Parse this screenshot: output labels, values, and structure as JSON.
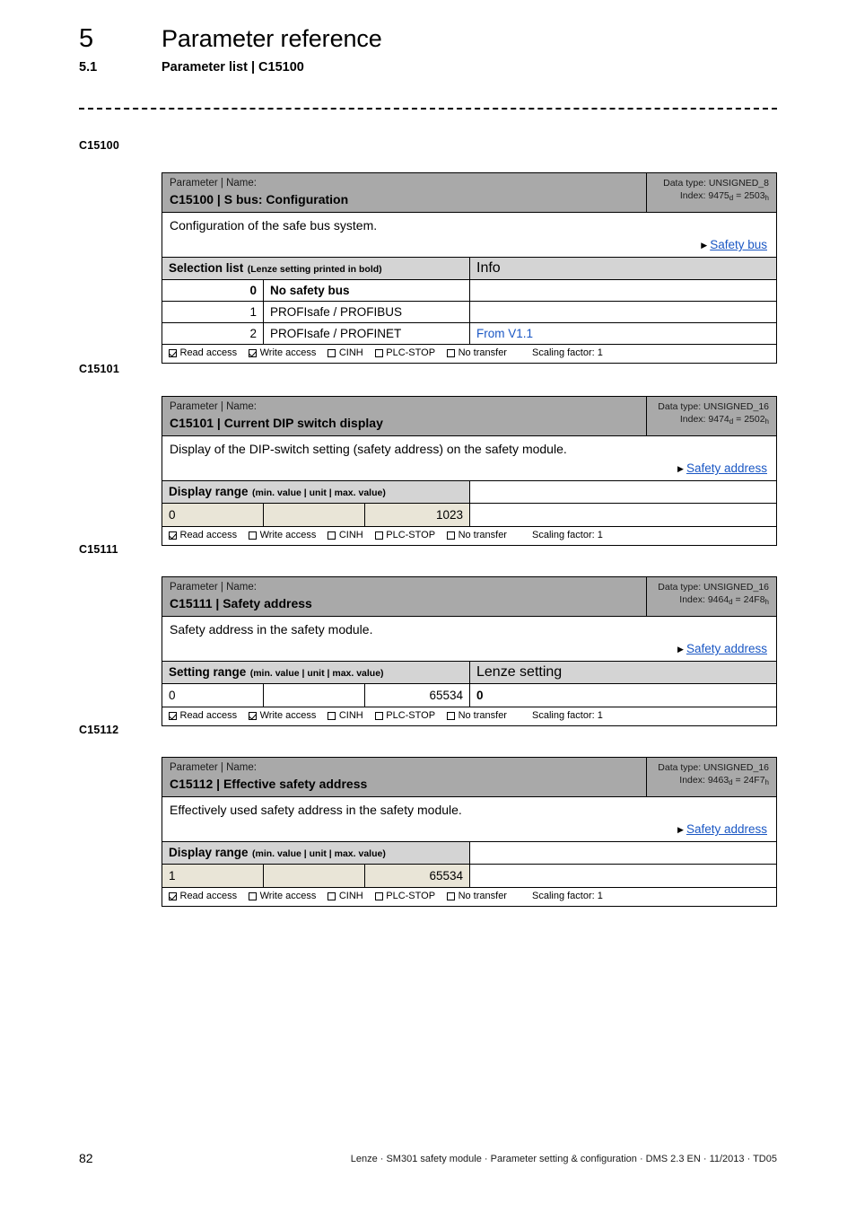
{
  "header": {
    "chapter_number": "5",
    "chapter_title": "Parameter reference",
    "section_number": "5.1",
    "section_title": "Parameter list | C15100"
  },
  "colors": {
    "header_band": "#a9a9a9",
    "subhead_band": "#d4d4d4",
    "readonly_value": "#e9e5d7",
    "link": "#1a57c4"
  },
  "access_labels": {
    "read": "Read access",
    "write": "Write access",
    "cinh": "CINH",
    "plc_stop": "PLC-STOP",
    "no_transfer": "No transfer"
  },
  "parameters": [
    {
      "margin_label": "C15100",
      "kicker": "Parameter | Name:",
      "title": "C15100 | S bus: Configuration",
      "data_type": "Data type: UNSIGNED_8",
      "index_label": "Index:",
      "index_dec": "9475",
      "index_dec_sub": "d",
      "index_eq": "=",
      "index_hex": "2503",
      "index_hex_sub": "h",
      "description": "Configuration of the safe bus system.",
      "xref": "Safety bus",
      "table_kind": "selection",
      "sub_header_left_strong": "Selection list",
      "sub_header_left_paren": "(Lenze setting printed in bold)",
      "sub_header_right": "Info",
      "rows": [
        {
          "code": "0",
          "name": "No safety bus",
          "info": "",
          "bold": true
        },
        {
          "code": "1",
          "name": "PROFIsafe / PROFIBUS",
          "info": "",
          "bold": false
        },
        {
          "code": "2",
          "name": "PROFIsafe / PROFINET",
          "info": "From V1.1",
          "bold": false
        }
      ],
      "access": {
        "read": true,
        "write": true,
        "cinh": false,
        "plc_stop": false,
        "no_transfer": false,
        "scaling": "Scaling factor: 1"
      }
    },
    {
      "margin_label": "C15101",
      "kicker": "Parameter | Name:",
      "title": "C15101 | Current DIP switch display",
      "data_type": "Data type: UNSIGNED_16",
      "index_label": "Index:",
      "index_dec": "9474",
      "index_dec_sub": "d",
      "index_eq": "=",
      "index_hex": "2502",
      "index_hex_sub": "h",
      "description": "Display of the DIP-switch setting (safety address) on the safety module.",
      "xref": "Safety address",
      "table_kind": "display_range",
      "sub_header_left_strong": "Display range",
      "sub_header_left_paren": "(min. value | unit | max. value)",
      "sub_header_right": "",
      "range": {
        "min": "0",
        "unit": "",
        "max": "1023",
        "rest": "",
        "readonly": true
      },
      "access": {
        "read": true,
        "write": false,
        "cinh": false,
        "plc_stop": false,
        "no_transfer": false,
        "scaling": "Scaling factor: 1"
      }
    },
    {
      "margin_label": "C15111",
      "kicker": "Parameter | Name:",
      "title": "C15111 | Safety address",
      "data_type": "Data type: UNSIGNED_16",
      "index_label": "Index:",
      "index_dec": "9464",
      "index_dec_sub": "d",
      "index_eq": "=",
      "index_hex": "24F8",
      "index_hex_sub": "h",
      "description": "Safety address in the safety module.",
      "xref": "Safety address",
      "table_kind": "setting_range",
      "sub_header_left_strong": "Setting range",
      "sub_header_left_paren": "(min. value | unit | max. value)",
      "sub_header_right": "Lenze setting",
      "range": {
        "min": "0",
        "unit": "",
        "max": "65534",
        "rest": "0",
        "readonly": false
      },
      "access": {
        "read": true,
        "write": true,
        "cinh": false,
        "plc_stop": false,
        "no_transfer": false,
        "scaling": "Scaling factor: 1"
      }
    },
    {
      "margin_label": "C15112",
      "kicker": "Parameter | Name:",
      "title": "C15112 | Effective safety address",
      "data_type": "Data type: UNSIGNED_16",
      "index_label": "Index:",
      "index_dec": "9463",
      "index_dec_sub": "d",
      "index_eq": "=",
      "index_hex": "24F7",
      "index_hex_sub": "h",
      "description": "Effectively used safety address in the safety module.",
      "xref": "Safety address",
      "table_kind": "display_range",
      "sub_header_left_strong": "Display range",
      "sub_header_left_paren": "(min. value | unit | max. value)",
      "sub_header_right": "",
      "range": {
        "min": "1",
        "unit": "",
        "max": "65534",
        "rest": "",
        "readonly": true
      },
      "access": {
        "read": true,
        "write": false,
        "cinh": false,
        "plc_stop": false,
        "no_transfer": false,
        "scaling": "Scaling factor: 1"
      }
    }
  ],
  "footer": {
    "page_number": "82",
    "text": "Lenze · SM301 safety module · Parameter setting & configuration · DMS 2.3 EN · 11/2013 · TD05"
  }
}
